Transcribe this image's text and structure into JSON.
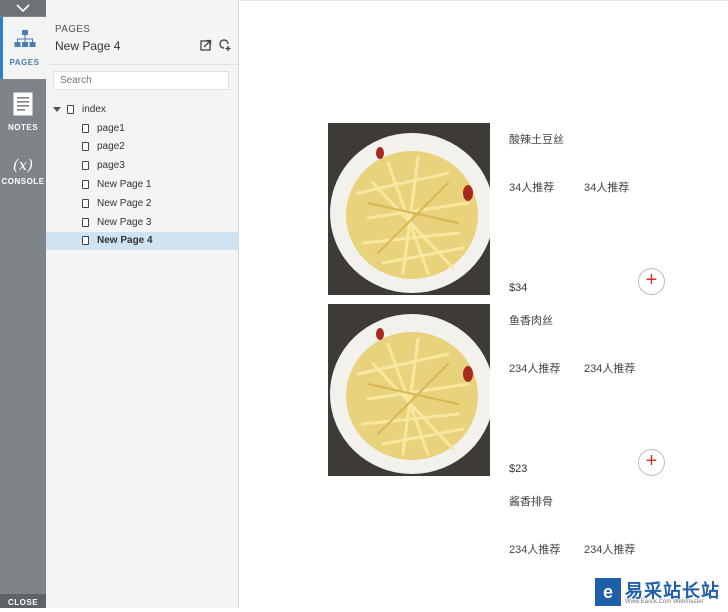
{
  "rail": {
    "pages_label": "PAGES",
    "notes_label": "NOTES",
    "console_label": "CONSOLE",
    "console_glyph": "(x)",
    "close_label": "CLOSE"
  },
  "panel": {
    "kicker": "PAGES",
    "title": "New Page 4",
    "search_placeholder": "Search",
    "tree": [
      {
        "label": "index",
        "level": 0,
        "selected": false
      },
      {
        "label": "page1",
        "level": 1,
        "selected": false
      },
      {
        "label": "page2",
        "level": 1,
        "selected": false
      },
      {
        "label": "page3",
        "level": 1,
        "selected": false
      },
      {
        "label": "New Page 1",
        "level": 1,
        "selected": false
      },
      {
        "label": "New Page 2",
        "level": 1,
        "selected": false
      },
      {
        "label": "New Page 3",
        "level": 1,
        "selected": false
      },
      {
        "label": "New Page 4",
        "level": 1,
        "selected": true
      }
    ]
  },
  "items": [
    {
      "name": "酸辣土豆丝",
      "rec1": "34人推荐",
      "rec2": "34人推荐",
      "price": "$34"
    },
    {
      "name": "鱼香肉丝",
      "rec1": "234人推荐",
      "rec2": "234人推荐",
      "price": "$23"
    },
    {
      "name": "酱香排骨",
      "rec1": "234人推荐",
      "rec2": "234人推荐"
    }
  ],
  "add_symbol": "+",
  "watermark": {
    "logo": "e",
    "text": "易采站长站",
    "small": "Www.Easck.Com  Webmaster"
  },
  "colors": {
    "accent": "#2c7fc9",
    "selected_row": "#cfe3f3",
    "rail": "#7f8488",
    "add_plus": "#d43030"
  }
}
